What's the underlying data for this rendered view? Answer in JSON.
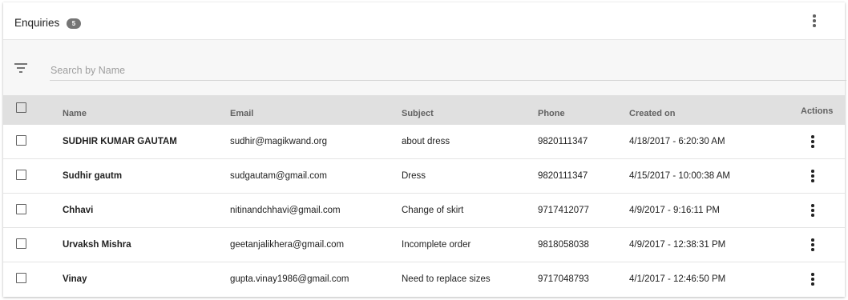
{
  "header": {
    "title": "Enquiries",
    "count": "5"
  },
  "search": {
    "placeholder": "Search by Name",
    "value": ""
  },
  "table": {
    "columns": {
      "name": "Name",
      "email": "Email",
      "subject": "Subject",
      "phone": "Phone",
      "created_on": "Created on",
      "actions": "Actions"
    },
    "rows": [
      {
        "name": "SUDHIR KUMAR GAUTAM",
        "email": "sudhir@magikwand.org",
        "subject": "about dress",
        "phone": "9820111347",
        "created_on": "4/18/2017 - 6:20:30 AM"
      },
      {
        "name": "Sudhir gautm",
        "email": "sudgautam@gmail.com",
        "subject": "Dress",
        "phone": "9820111347",
        "created_on": "4/15/2017 - 10:00:38 AM"
      },
      {
        "name": "Chhavi",
        "email": "nitinandchhavi@gmail.com",
        "subject": "Change of skirt",
        "phone": "9717412077",
        "created_on": "4/9/2017 - 9:16:11 PM"
      },
      {
        "name": "Urvaksh Mishra",
        "email": "geetanjalikhera@gmail.com",
        "subject": "Incomplete order",
        "phone": "9818058038",
        "created_on": "4/9/2017 - 12:38:31 PM"
      },
      {
        "name": "Vinay",
        "email": "gupta.vinay1986@gmail.com",
        "subject": "Need to replace sizes",
        "phone": "9717048793",
        "created_on": "4/1/2017 - 12:46:50 PM"
      }
    ]
  },
  "icons": {
    "filter": "filter-icon",
    "more": "more-vert-icon"
  }
}
